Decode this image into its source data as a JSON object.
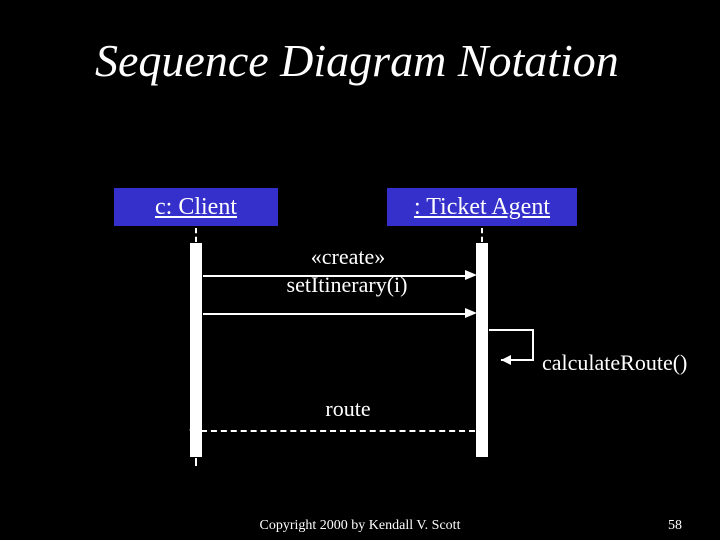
{
  "title": "Sequence Diagram Notation",
  "objects": {
    "client": "c: Client",
    "agent": ": Ticket Agent"
  },
  "messages": {
    "create": "«create»",
    "setItinerary": "setItinerary(i)",
    "route": "route",
    "calculateRoute": "calculateRoute()"
  },
  "footer": {
    "copyright": "Copyright 2000 by Kendall V. Scott",
    "page": "58"
  }
}
